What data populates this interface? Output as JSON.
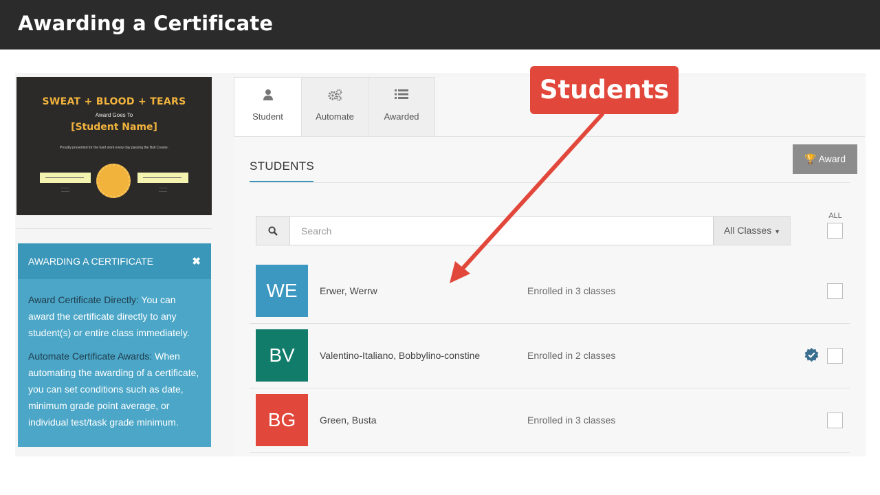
{
  "page": {
    "title": "Awarding a Certificate"
  },
  "certificate": {
    "title": "SWEAT + BLOOD + TEARS",
    "award_goes_to": "Award Goes To",
    "name": "[Student Name]",
    "fine_print": "Proudly presented for the hard work every day passing the Bull Course."
  },
  "help": {
    "heading": "AWARDING A CERTIFICATE",
    "close_glyph": "✖",
    "p1_label": "Award Certificate Directly:",
    "p1_text": " You can award the certificate directly to any student(s) or entire class immediately.",
    "p2_label": "Automate Certificate Awards:",
    "p2_text": " When automating the awarding of a certificate, you can set conditions such as date, minimum grade point average, or individual test/task grade minimum."
  },
  "tabs": [
    {
      "label": "Student",
      "icon": "user-icon",
      "active": true
    },
    {
      "label": "Automate",
      "icon": "gears-icon",
      "active": false
    },
    {
      "label": "Awarded",
      "icon": "list-icon",
      "active": false
    }
  ],
  "students_title": "STUDENTS",
  "award_button": {
    "icon": "trophy-icon",
    "label": "Award"
  },
  "search": {
    "placeholder": "Search",
    "value": ""
  },
  "classes_filter": {
    "label": "All Classes",
    "icon": "caret-down-icon"
  },
  "select_all_label": "ALL",
  "students": [
    {
      "initials": "WE",
      "name": "Erwer, Werrw",
      "enrollment": "Enrolled in 3 classes",
      "color": "#3d98c1",
      "verified": false
    },
    {
      "initials": "BV",
      "name": "Valentino-Italiano, Bobbylino-constine",
      "enrollment": "Enrolled in 2 classes",
      "color": "#127c6b",
      "verified": true
    },
    {
      "initials": "BG",
      "name": "Green, Busta",
      "enrollment": "Enrolled in 3 classes",
      "color": "#e2473b",
      "verified": false
    }
  ],
  "callout": {
    "label": "Students",
    "color": "#e2473b"
  },
  "colors": {
    "accent": "#3b97b9",
    "topbar": "#2b2b2b",
    "help_box": "#4ba6c7"
  }
}
